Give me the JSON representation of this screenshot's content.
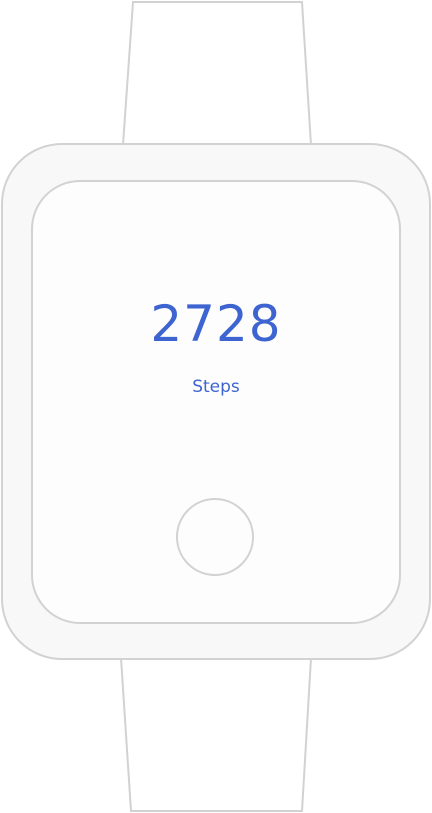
{
  "watch": {
    "steps_value": "2728",
    "steps_label": "Steps"
  },
  "colors": {
    "accent": "#3d64d0",
    "outline": "#d2d2d2",
    "case_fill": "#f8f8f8",
    "screen_fill": "#fdfdfd"
  }
}
